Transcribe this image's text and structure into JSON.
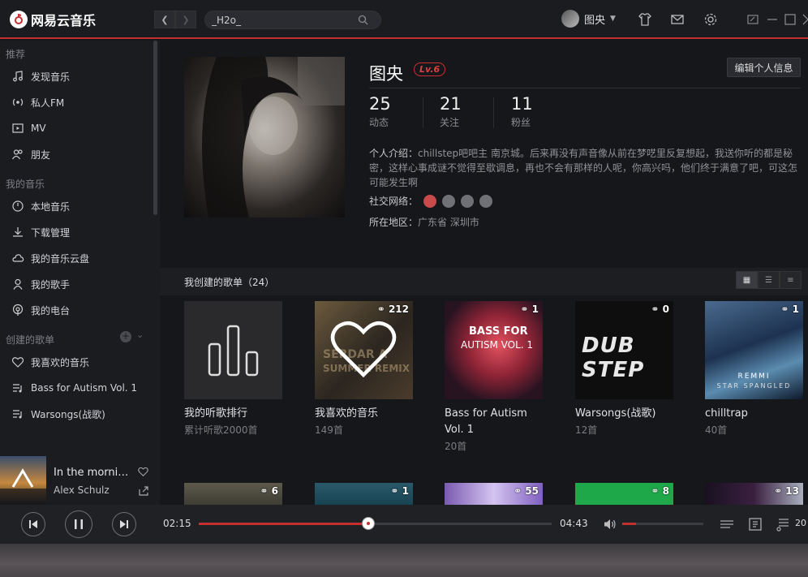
{
  "app": {
    "title": "网易云音乐"
  },
  "search": {
    "value": "_H2o_"
  },
  "user": {
    "name": "图央"
  },
  "sidebar": {
    "sections": [
      {
        "title": "推荐",
        "items": [
          {
            "label": "发现音乐",
            "icon": "music-note-icon"
          },
          {
            "label": "私人FM",
            "icon": "radio-icon"
          },
          {
            "label": "MV",
            "icon": "video-icon"
          },
          {
            "label": "朋友",
            "icon": "friends-icon"
          }
        ]
      },
      {
        "title": "我的音乐",
        "items": [
          {
            "label": "本地音乐",
            "icon": "local-music-icon"
          },
          {
            "label": "下载管理",
            "icon": "download-icon"
          },
          {
            "label": "我的音乐云盘",
            "icon": "cloud-icon"
          },
          {
            "label": "我的歌手",
            "icon": "singer-icon"
          },
          {
            "label": "我的电台",
            "icon": "podcast-icon"
          }
        ]
      },
      {
        "title": "创建的歌单",
        "items": [
          {
            "label": "我喜欢的音乐",
            "icon": "heart-icon"
          },
          {
            "label": "Bass for Autism Vol. 1",
            "icon": "playlist-icon"
          },
          {
            "label": "Warsongs(战歌)",
            "icon": "playlist-icon"
          }
        ]
      }
    ]
  },
  "now_playing": {
    "title": "In the mornin...",
    "artist": "Alex Schulz"
  },
  "profile": {
    "name": "图央",
    "level": "Lv.6",
    "edit_label": "编辑个人信息",
    "stats": [
      {
        "value": "25",
        "label": "动态"
      },
      {
        "value": "21",
        "label": "关注"
      },
      {
        "value": "11",
        "label": "粉丝"
      }
    ],
    "intro_label": "个人介绍：",
    "intro_text": "chillstep吧吧主 南京城。后来再没有声音像从前在梦呓里反复想起，我送你听的都是秘密，这样心事成谜不觉得至歇调息，再也不会有那样的人呢，你高兴吗，他们终于满意了吧，可这怎可能发生啊",
    "social_label": "社交网络：",
    "region_label": "所在地区：",
    "region_value": "广东省 深圳市"
  },
  "playlists": {
    "header": "我创建的歌单（24）",
    "items": [
      {
        "title": "我的听歌排行",
        "sub": "累计听歌2000首",
        "count": ""
      },
      {
        "title": "我喜欢的音乐",
        "sub": "149首",
        "count": "212"
      },
      {
        "title": "Bass for Autism Vol. 1",
        "sub": "20首",
        "count": "1"
      },
      {
        "title": "Warsongs(战歌)",
        "sub": "12首",
        "count": "0"
      },
      {
        "title": "chilltrap",
        "sub": "40首",
        "count": "1"
      }
    ],
    "row2_counts": [
      "6",
      "1",
      "55",
      "8",
      "13"
    ],
    "cover_text": {
      "c1a": "SERDAR A",
      "c1b": "SUMMER REMIX",
      "c2a": "BASS FOR",
      "c2b": "AUTISM VOL. 1",
      "c3": "DUB STEP",
      "c4a": "REMMI",
      "c4b": "STAR SPANGLED"
    }
  },
  "player": {
    "elapsed": "02:15",
    "total": "04:43",
    "progress": 0.48,
    "volume": 0.17,
    "playlist_count": "20"
  }
}
